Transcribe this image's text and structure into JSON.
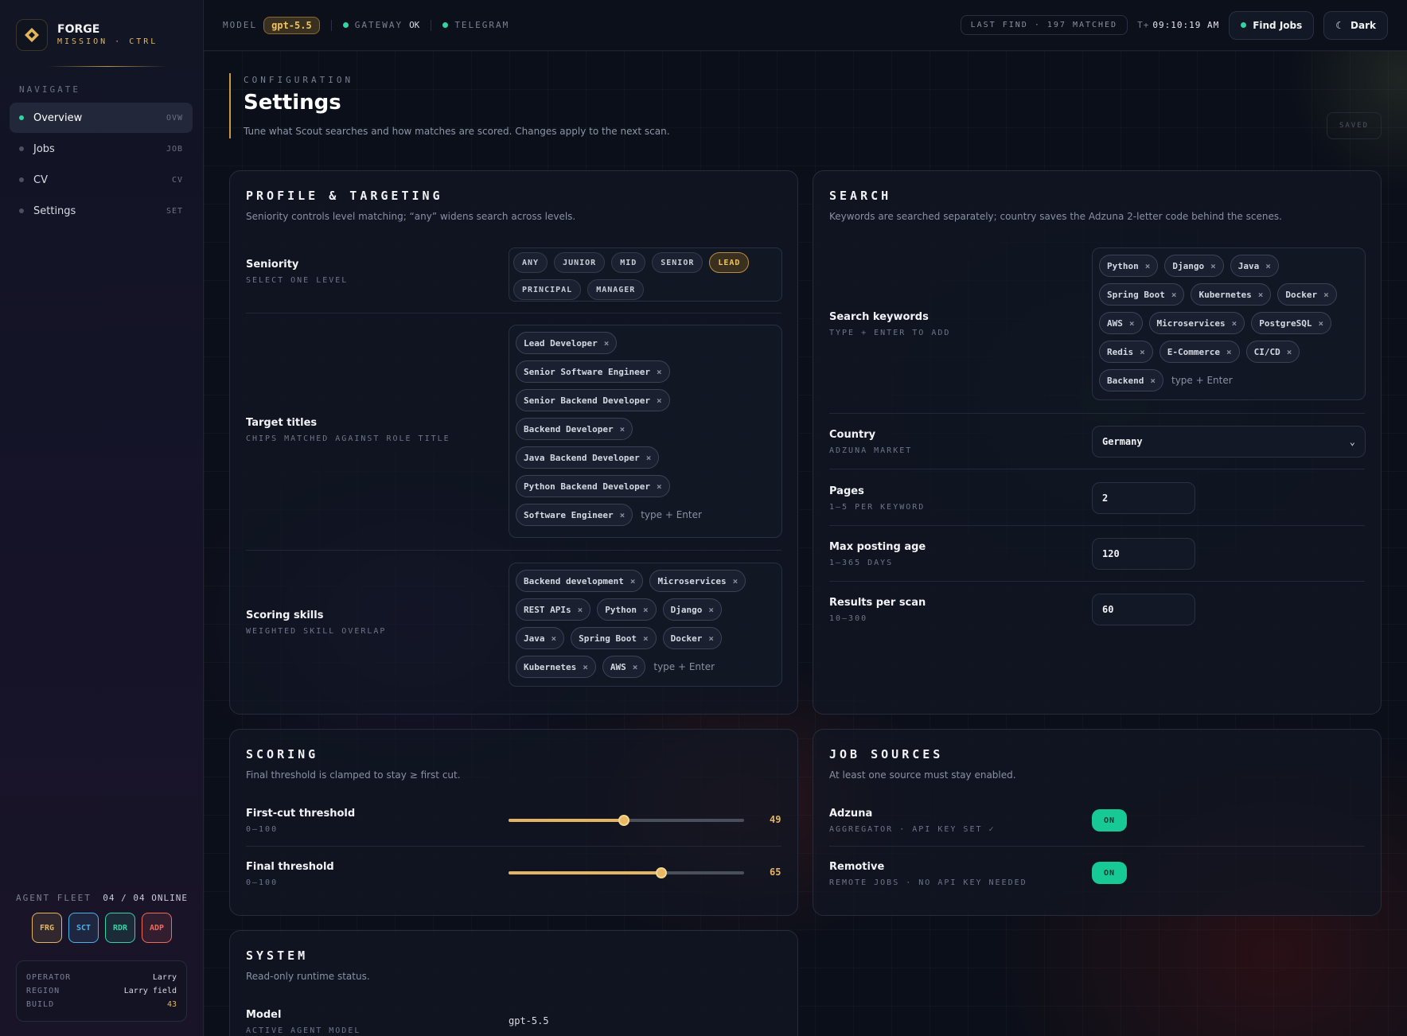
{
  "brand": {
    "name": "FORGE",
    "sub": "MISSION · CTRL"
  },
  "nav": {
    "label": "NAVIGATE",
    "items": [
      {
        "label": "Overview",
        "code": "OVW"
      },
      {
        "label": "Jobs",
        "code": "JOB"
      },
      {
        "label": "CV",
        "code": "CV"
      },
      {
        "label": "Settings",
        "code": "SET"
      }
    ]
  },
  "fleet": {
    "label": "AGENT FLEET",
    "count": "04 / 04 ONLINE",
    "badges": [
      {
        "code": "FRG",
        "color": "#e3b65c"
      },
      {
        "code": "SCT",
        "color": "#4ab3ea"
      },
      {
        "code": "RDR",
        "color": "#2fd6a3"
      },
      {
        "code": "ADP",
        "color": "#f06a5a"
      }
    ]
  },
  "operator": {
    "rows": [
      {
        "k": "OPERATOR",
        "v": "Larry"
      },
      {
        "k": "REGION",
        "v": "Larry field"
      },
      {
        "k": "BUILD",
        "v": "43"
      }
    ]
  },
  "topbar": {
    "model_label": "MODEL",
    "model": "gpt-5.5",
    "gateway_label": "GATEWAY",
    "gateway_status": "OK",
    "telegram_label": "TELEGRAM",
    "last_find": "LAST FIND · 197 MATCHED",
    "clock_prefix": "T+",
    "clock": "09:10:19 AM",
    "find_jobs": "Find Jobs",
    "theme": "Dark"
  },
  "page": {
    "eyebrow": "CONFIGURATION",
    "title": "Settings",
    "subtitle": "Tune what Scout searches and how matches are scored. Changes apply to the next scan.",
    "saved": "SAVED"
  },
  "profile": {
    "title": "PROFILE & TARGETING",
    "desc": "Seniority controls level matching; “any” widens search across levels.",
    "seniority": {
      "label": "Seniority",
      "sub": "SELECT ONE LEVEL",
      "options": [
        "ANY",
        "JUNIOR",
        "MID",
        "SENIOR",
        "LEAD",
        "PRINCIPAL",
        "MANAGER"
      ],
      "selected": "LEAD"
    },
    "titles": {
      "label": "Target titles",
      "sub": "CHIPS MATCHED AGAINST ROLE TITLE",
      "chips": [
        "Lead Developer",
        "Senior Software Engineer",
        "Senior Backend Developer",
        "Backend Developer",
        "Java Backend Developer",
        "Python Backend Developer",
        "Software Engineer"
      ],
      "placeholder": "type + Enter"
    },
    "skills": {
      "label": "Scoring skills",
      "sub": "WEIGHTED SKILL OVERLAP",
      "chips": [
        "Backend development",
        "Microservices",
        "REST APIs",
        "Python",
        "Django",
        "Java",
        "Spring Boot",
        "Docker",
        "Kubernetes",
        "AWS"
      ],
      "placeholder": "type + Enter"
    }
  },
  "search": {
    "title": "SEARCH",
    "desc": "Keywords are searched separately; country saves the Adzuna 2-letter code behind the scenes.",
    "keywords": {
      "label": "Search keywords",
      "sub": "TYPE + ENTER TO ADD",
      "chips": [
        "Python",
        "Django",
        "Java",
        "Spring Boot",
        "Kubernetes",
        "Docker",
        "AWS",
        "Microservices",
        "PostgreSQL",
        "Redis",
        "E-Commerce",
        "CI/CD",
        "Backend"
      ],
      "placeholder": "type + Enter"
    },
    "country": {
      "label": "Country",
      "sub": "ADZUNA MARKET",
      "value": "Germany"
    },
    "pages": {
      "label": "Pages",
      "sub": "1–5 PER KEYWORD",
      "value": "2"
    },
    "max_age": {
      "label": "Max posting age",
      "sub": "1–365 DAYS",
      "value": "120"
    },
    "results": {
      "label": "Results per scan",
      "sub": "10–300",
      "value": "60"
    }
  },
  "scoring": {
    "title": "SCORING",
    "desc": "Final threshold is clamped to stay ≥ first cut.",
    "first": {
      "label": "First-cut threshold",
      "sub": "0–100",
      "value": 49
    },
    "final": {
      "label": "Final threshold",
      "sub": "0–100",
      "value": 65
    }
  },
  "sources": {
    "title": "JOB SOURCES",
    "desc": "At least one source must stay enabled.",
    "adzuna": {
      "label": "Adzuna",
      "sub": "AGGREGATOR · API KEY SET ✓",
      "state": "ON"
    },
    "remotive": {
      "label": "Remotive",
      "sub": "REMOTE JOBS · NO API KEY NEEDED",
      "state": "ON"
    }
  },
  "system": {
    "title": "SYSTEM",
    "desc": "Read-only runtime status.",
    "model": {
      "label": "Model",
      "sub": "ACTIVE AGENT MODEL",
      "value": "gpt-5.5"
    }
  },
  "colors": {
    "accent": "#e3b563",
    "ok": "#2fd6a3",
    "bg": "#0b0f19"
  }
}
